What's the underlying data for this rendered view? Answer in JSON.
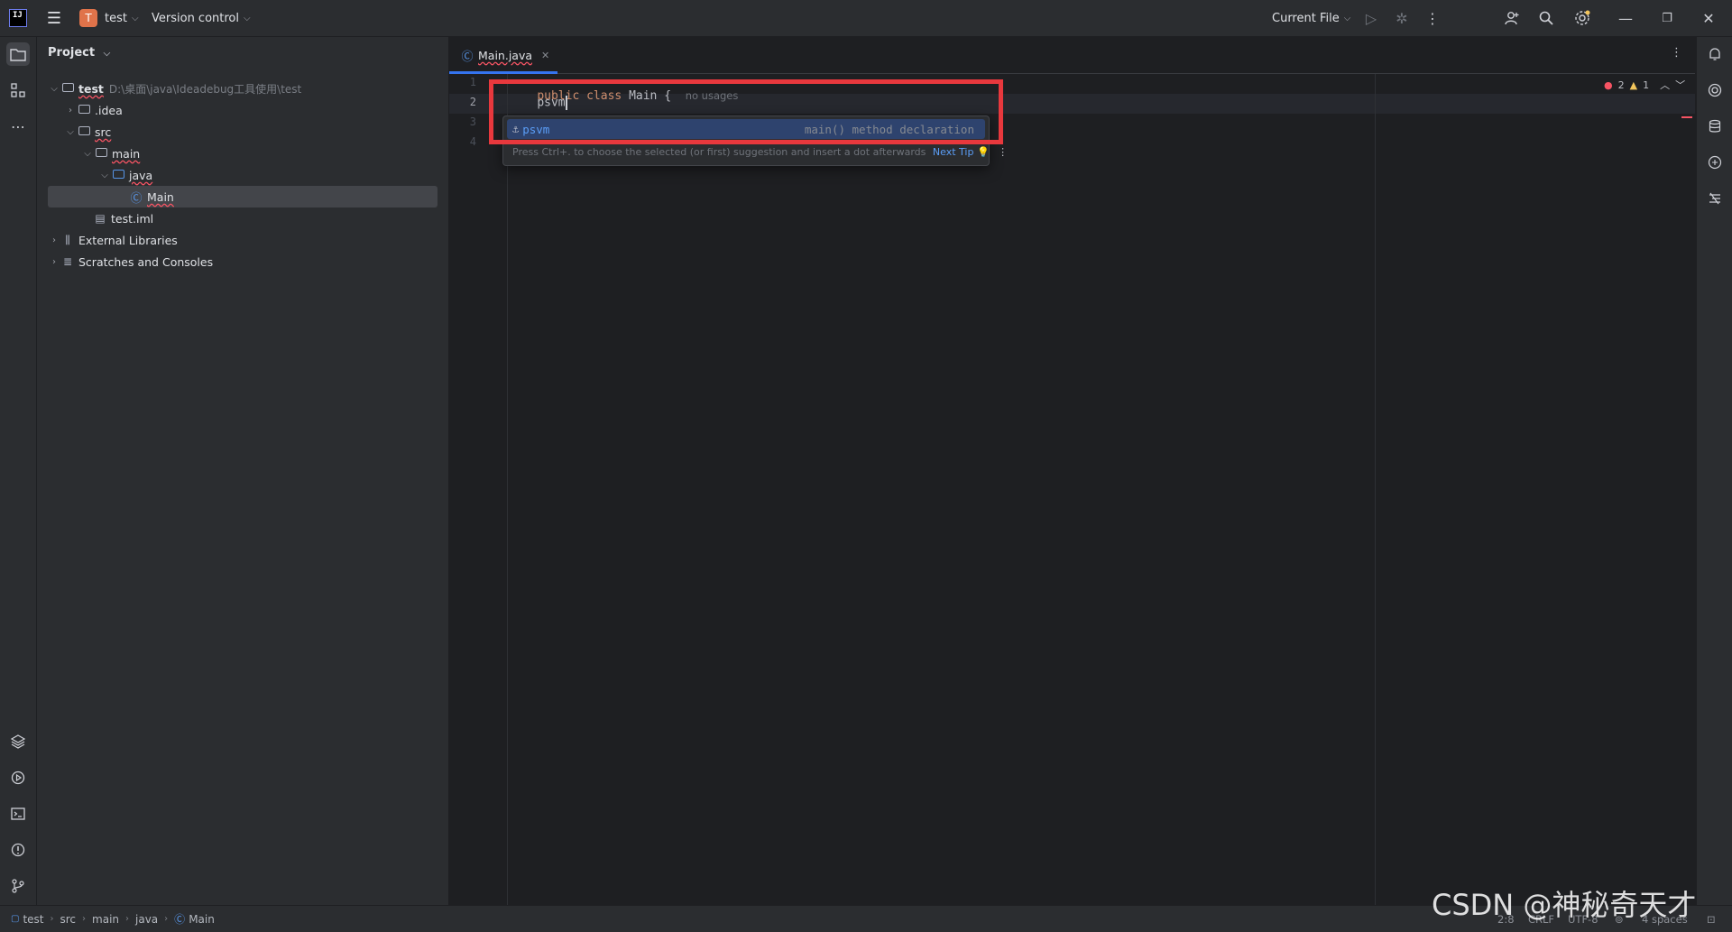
{
  "titlebar": {
    "project_badge": "T",
    "project_name": "test",
    "version_control": "Version control",
    "run_config": "Current File"
  },
  "project_panel": {
    "title": "Project",
    "tree": [
      {
        "label": "test",
        "path": "D:\\桌面\\java\\Ideadebug工具使用\\test",
        "depth": 0,
        "expanded": true,
        "icon": "module-folder-icon"
      },
      {
        "label": ".idea",
        "depth": 1,
        "expanded": false,
        "icon": "folder-icon"
      },
      {
        "label": "src",
        "depth": 1,
        "expanded": true,
        "icon": "folder-icon"
      },
      {
        "label": "main",
        "depth": 2,
        "expanded": true,
        "icon": "folder-icon"
      },
      {
        "label": "java",
        "depth": 3,
        "expanded": true,
        "icon": "source-folder-icon"
      },
      {
        "label": "Main",
        "depth": 4,
        "icon": "java-class-icon",
        "selected": true
      },
      {
        "label": "test.iml",
        "depth": 2,
        "icon": "iml-file-icon"
      },
      {
        "label": "External Libraries",
        "depth": 0,
        "expanded": false,
        "icon": "libraries-icon"
      },
      {
        "label": "Scratches and Consoles",
        "depth": 0,
        "expanded": false,
        "icon": "scratches-icon"
      }
    ]
  },
  "editor": {
    "tab_label": "Main.java",
    "line_numbers": [
      "1",
      "2",
      "3",
      "4"
    ],
    "line1_kw1": "public",
    "line1_kw2": "class",
    "line1_name": "Main",
    "line1_brace": "{",
    "line1_hint": "no usages",
    "line2_text": "psvm",
    "error_count": "2",
    "warning_count": "1"
  },
  "completion": {
    "item_label": "psvm",
    "item_description": "main() method declaration",
    "tip_text": "Press Ctrl+. to choose the selected (or first) suggestion and insert a dot afterwards",
    "tip_link": "Next Tip"
  },
  "statusbar": {
    "breadcrumbs": [
      "test",
      "src",
      "main",
      "java",
      "Main"
    ],
    "position": "2:8",
    "line_sep": "CRLF",
    "encoding": "UTF-8",
    "indent": "4 spaces"
  },
  "watermark": "CSDN @神秘奇天才",
  "colors": {
    "accent": "#3574f0",
    "error": "#f75464",
    "highlight_box": "#e8383d"
  }
}
